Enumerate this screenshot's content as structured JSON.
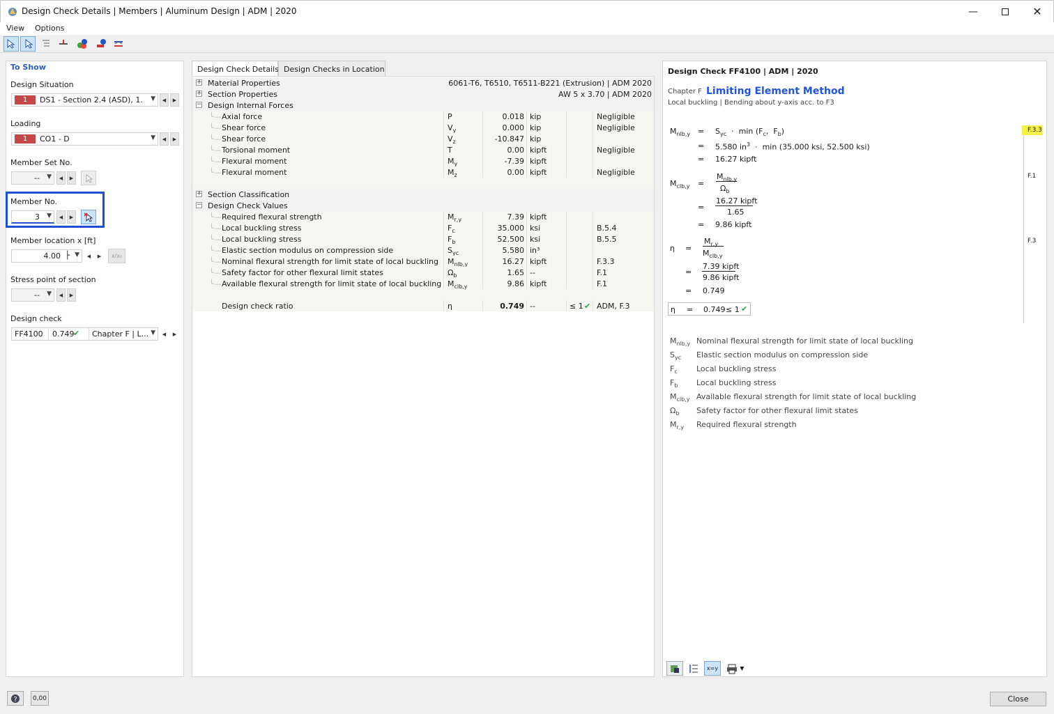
{
  "window": {
    "title": "Design Check Details | Members | Aluminum Design | ADM | 2020"
  },
  "menu": [
    "View",
    "Options"
  ],
  "left": {
    "section_title": "To Show",
    "design_situation": {
      "label": "Design Situation",
      "num": "1",
      "value": "DS1 - Section 2.4 (ASD), 1."
    },
    "loading": {
      "label": "Loading",
      "num": "1",
      "value": "CO1 - D"
    },
    "member_set": {
      "label": "Member Set No.",
      "value": "--"
    },
    "member_no": {
      "label": "Member No.",
      "value": "3"
    },
    "member_loc": {
      "label": "Member location x [ft]",
      "value": "4.00"
    },
    "stress_point": {
      "label": "Stress point of section",
      "value": "--"
    },
    "design_check": {
      "label": "Design check",
      "code": "FF4100",
      "ratio": "0.749",
      "chapter": "Chapter F | L..."
    }
  },
  "tabs": [
    "Design Check Details",
    "Design Checks in Location"
  ],
  "tree": {
    "material": {
      "label": "Material Properties",
      "value": "6061-T6, T6510, T6511-B221 (Extrusion) | ADM 2020"
    },
    "section": {
      "label": "Section Properties",
      "value": "AW 5 x 3.70 | ADM 2020"
    },
    "forces_label": "Design Internal Forces",
    "forces": [
      {
        "name": "Axial force",
        "sym": "P",
        "sub": "",
        "val": "0.018",
        "unit": "kip",
        "note": "Negligible"
      },
      {
        "name": "Shear force",
        "sym": "V",
        "sub": "y",
        "val": "0.000",
        "unit": "kip",
        "note": "Negligible"
      },
      {
        "name": "Shear force",
        "sym": "V",
        "sub": "z",
        "val": "-10.847",
        "unit": "kip",
        "note": ""
      },
      {
        "name": "Torsional moment",
        "sym": "T",
        "sub": "",
        "val": "0.00",
        "unit": "kipft",
        "note": "Negligible"
      },
      {
        "name": "Flexural moment",
        "sym": "M",
        "sub": "y",
        "val": "-7.39",
        "unit": "kipft",
        "note": ""
      },
      {
        "name": "Flexural moment",
        "sym": "M",
        "sub": "z",
        "val": "0.00",
        "unit": "kipft",
        "note": "Negligible"
      }
    ],
    "classification_label": "Section Classification",
    "values_label": "Design Check Values",
    "values": [
      {
        "name": "Required flexural strength",
        "sym": "M",
        "sub": "r,y",
        "val": "7.39",
        "unit": "kipft",
        "ref": ""
      },
      {
        "name": "Local buckling stress",
        "sym": "F",
        "sub": "c",
        "val": "35.000",
        "unit": "ksi",
        "ref": "B.5.4"
      },
      {
        "name": "Local buckling stress",
        "sym": "F",
        "sub": "b",
        "val": "52.500",
        "unit": "ksi",
        "ref": "B.5.5"
      },
      {
        "name": "Elastic section modulus on compression side",
        "sym": "S",
        "sub": "yc",
        "val": "5.580",
        "unit": "in³",
        "ref": ""
      },
      {
        "name": "Nominal flexural strength for limit state of local buckling",
        "sym": "M",
        "sub": "nlb,y",
        "val": "16.27",
        "unit": "kipft",
        "ref": "F.3.3"
      },
      {
        "name": "Safety factor for other flexural limit states",
        "sym": "Ω",
        "sub": "b",
        "val": "1.65",
        "unit": "--",
        "ref": "F.1"
      },
      {
        "name": "Available flexural strength for limit state of local buckling",
        "sym": "M",
        "sub": "clb,y",
        "val": "9.86",
        "unit": "kipft",
        "ref": "F.1"
      }
    ],
    "ratio": {
      "name": "Design check ratio",
      "sym": "η",
      "val": "0.749",
      "unit": "--",
      "limit": "≤ 1",
      "ref": "ADM, F.3"
    }
  },
  "detail": {
    "heading": "Design Check FF4100 | ADM | 2020",
    "chapter": "Chapter F",
    "method": "Limiting Element Method",
    "subtitle": "Local buckling | Bending about y-axis acc. to F3",
    "eq1_l1": "min (F",
    "eq1_l2": "5.580 in",
    "eq1_l2b": "min (35.000 ksi,  52.500 ksi)",
    "eq1_l3": "16.27 kipft",
    "eq2_num": "16.27 kipft",
    "eq2_den": "1.65",
    "eq2_res": "9.86 kipft",
    "eq3_num": "7.39 kipft",
    "eq3_den": "9.86 kipft",
    "eq3_res": "0.749",
    "final": "0.749",
    "final_lim": "≤ 1",
    "refs": [
      "F.3.3",
      "F.1",
      "F.3"
    ],
    "legend": [
      {
        "sym": "M",
        "sub": "nlb,y",
        "text": "Nominal flexural strength for limit state of local buckling"
      },
      {
        "sym": "S",
        "sub": "yc",
        "text": "Elastic section modulus on compression side"
      },
      {
        "sym": "F",
        "sub": "c",
        "text": "Local buckling stress"
      },
      {
        "sym": "F",
        "sub": "b",
        "text": "Local buckling stress"
      },
      {
        "sym": "M",
        "sub": "clb,y",
        "text": "Available flexural strength for limit state of local buckling"
      },
      {
        "sym": "Ω",
        "sub": "b",
        "text": "Safety factor for other flexural limit states"
      },
      {
        "sym": "M",
        "sub": "r,y",
        "text": "Required flexural strength"
      }
    ]
  },
  "footer": {
    "close": "Close",
    "units": "0,00"
  }
}
